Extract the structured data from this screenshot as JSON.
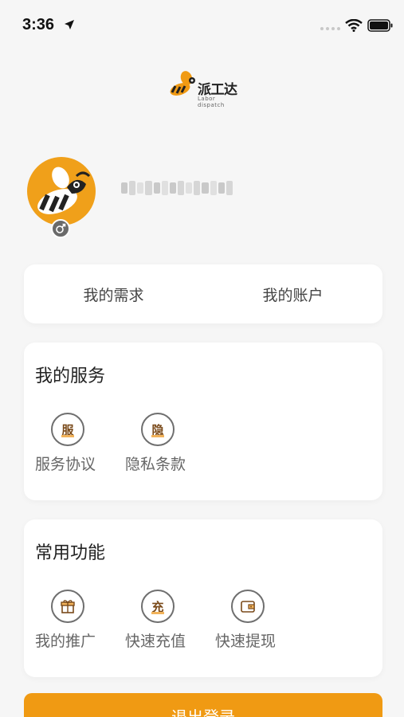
{
  "status_bar": {
    "time": "3:36"
  },
  "logo": {
    "name": "派工达",
    "subtitle": "Labor dispatch",
    "brand_color": "#f09a13"
  },
  "profile": {
    "avatar_icon": "bee-icon",
    "gender_icon": "male-icon",
    "phone_masked": true
  },
  "tabs": [
    {
      "label": "我的需求"
    },
    {
      "label": "我的账户"
    }
  ],
  "services": {
    "title": "我的服务",
    "items": [
      {
        "icon_char": "服",
        "label": "服务协议"
      },
      {
        "icon_char": "隐",
        "label": "隐私条款"
      }
    ]
  },
  "common": {
    "title": "常用功能",
    "items": [
      {
        "icon": "gift-icon",
        "label": "我的推广"
      },
      {
        "icon_char": "充",
        "label": "快速充值"
      },
      {
        "icon": "wallet-icon",
        "label": "快速提现"
      }
    ]
  },
  "logout": {
    "label": "退出登录"
  }
}
